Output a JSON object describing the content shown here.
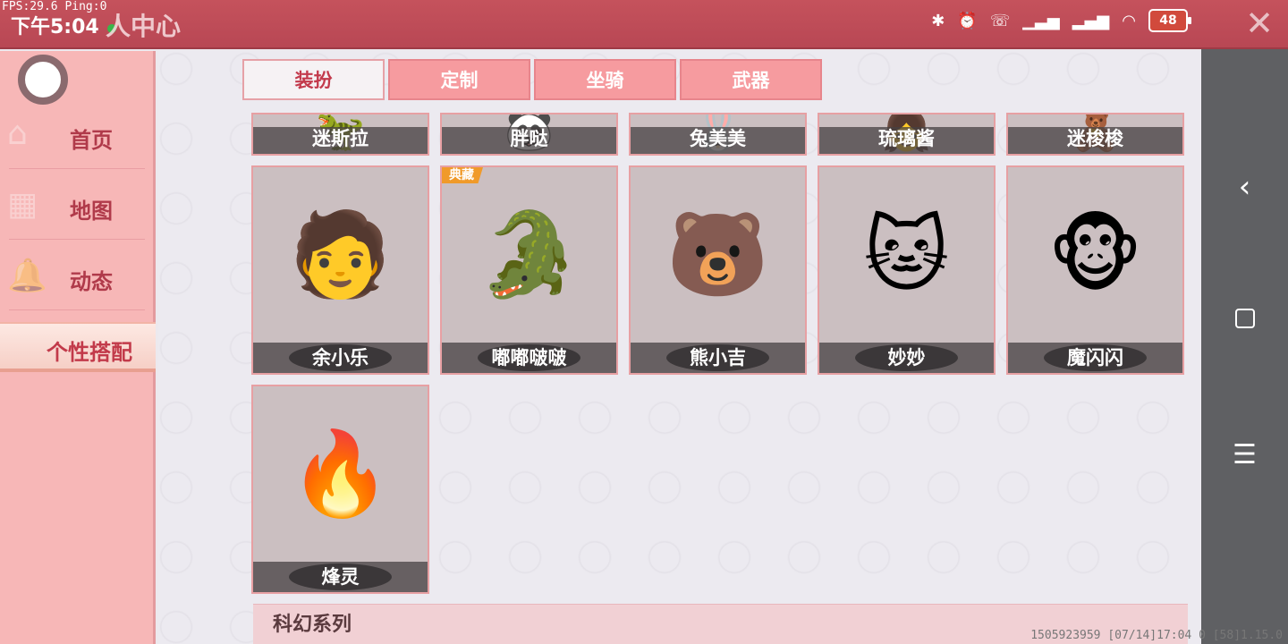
{
  "status_bar": {
    "fps_text": "FPS:29.6  Ping:0",
    "clock": "下午5:04",
    "page_title": "人中心",
    "battery": "48",
    "icons": [
      "bluetooth-icon",
      "alarm-icon",
      "call-icon",
      "signal-icon",
      "hd-signal-icon",
      "wifi-icon"
    ]
  },
  "close_label": "✕",
  "sidebar": {
    "items": [
      {
        "label": "首页",
        "icon": "house-icon"
      },
      {
        "label": "地图",
        "icon": "map-icon"
      },
      {
        "label": "动态",
        "icon": "bell-icon"
      },
      {
        "label": "个性搭配",
        "icon": "outfit-icon",
        "active": true
      }
    ]
  },
  "tabs": [
    {
      "label": "装扮",
      "active": true
    },
    {
      "label": "定制"
    },
    {
      "label": "坐骑"
    },
    {
      "label": "武器"
    }
  ],
  "top_row": [
    {
      "name": "迷斯拉",
      "emoji": "🦖"
    },
    {
      "name": "胖哒",
      "emoji": "🐼"
    },
    {
      "name": "兔美美",
      "emoji": "🐰"
    },
    {
      "name": "琉璃酱",
      "emoji": "👧"
    },
    {
      "name": "迷梭梭",
      "emoji": "🧸"
    }
  ],
  "skins": [
    {
      "name": "余小乐",
      "emoji": "🧑"
    },
    {
      "name": "嘟嘟啵啵",
      "emoji": "🐊",
      "badge": "典藏"
    },
    {
      "name": "熊小吉",
      "emoji": "🐻"
    },
    {
      "name": "妙妙",
      "emoji": "🐱"
    },
    {
      "name": "魔闪闪",
      "emoji": "🐵"
    },
    {
      "name": "烽灵",
      "emoji": "🔥"
    }
  ],
  "section_title": "科幻系列",
  "footer": "1505923959   [07/14]17:04 0  [58]1.15.0",
  "android_nav": {
    "back": "‹",
    "menu": "☰"
  }
}
